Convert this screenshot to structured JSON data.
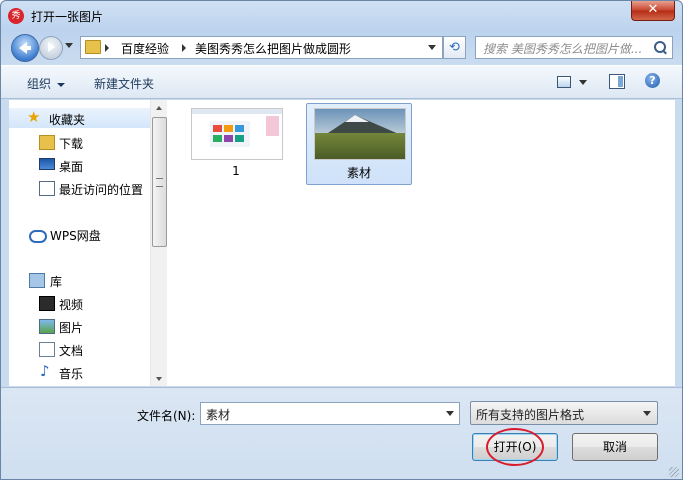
{
  "window": {
    "title": "打开一张图片",
    "app_icon_glyph": "秀",
    "close_glyph": "✕"
  },
  "navigation": {
    "breadcrumbs": [
      "百度经验",
      "美图秀秀怎么把图片做成圆形"
    ],
    "refresh_glyph": "⟲",
    "search_placeholder": "搜索 美图秀秀怎么把图片做..."
  },
  "toolbar": {
    "organize_label": "组织",
    "new_folder_label": "新建文件夹",
    "help_glyph": "?"
  },
  "sidebar": {
    "items": [
      {
        "label": "收藏夹",
        "icon": "star-icon"
      },
      {
        "label": "下载",
        "icon": "download-folder-icon"
      },
      {
        "label": "桌面",
        "icon": "desktop-icon"
      },
      {
        "label": "最近访问的位置",
        "icon": "recent-places-icon"
      },
      {
        "label": "WPS网盘",
        "icon": "cloud-icon"
      },
      {
        "label": "库",
        "icon": "library-icon"
      },
      {
        "label": "视频",
        "icon": "video-icon"
      },
      {
        "label": "图片",
        "icon": "pictures-icon"
      },
      {
        "label": "文档",
        "icon": "documents-icon"
      },
      {
        "label": "音乐",
        "icon": "music-icon"
      }
    ]
  },
  "files": [
    {
      "name": "1",
      "selected": false
    },
    {
      "name": "素材",
      "selected": true
    }
  ],
  "bottom": {
    "filename_label": "文件名(N):",
    "filename_value": "素材",
    "filetype_value": "所有支持的图片格式",
    "open_label": "打开(O)",
    "cancel_label": "取消"
  },
  "colors": {
    "annotation_circle": "#d81c2c",
    "selection": "#cfe2f9"
  }
}
